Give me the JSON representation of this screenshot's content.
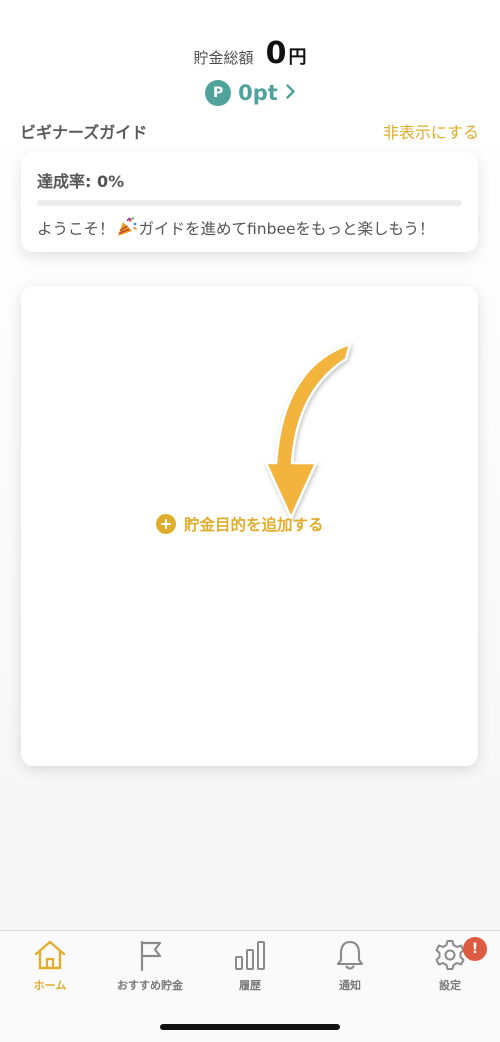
{
  "header": {
    "total_label": "貯金総額",
    "total_value": "0",
    "total_unit": "円",
    "points_badge": "P",
    "points_value": "0pt",
    "points_chevron": "›"
  },
  "guide": {
    "title": "ビギナーズガイド",
    "hide_label": "非表示にする",
    "progress_label": "達成率: 0%",
    "progress": 0,
    "message_before": "ようこそ！",
    "message_after": "ガイドを進めてfinbeeをもっと楽しもう！"
  },
  "main": {
    "add_goal_label": "貯金目的を追加する"
  },
  "tabs": [
    {
      "label": "ホーム",
      "icon": "home-icon",
      "active": true
    },
    {
      "label": "おすすめ貯金",
      "icon": "flag-icon",
      "active": false
    },
    {
      "label": "履歴",
      "icon": "bar-chart-icon",
      "active": false
    },
    {
      "label": "通知",
      "icon": "bell-icon",
      "active": false
    },
    {
      "label": "設定",
      "icon": "gear-icon",
      "active": false,
      "badge": "!"
    }
  ],
  "colors": {
    "accent": "#e0ad2c",
    "points": "#4fa39a",
    "badge": "#de5b43"
  }
}
